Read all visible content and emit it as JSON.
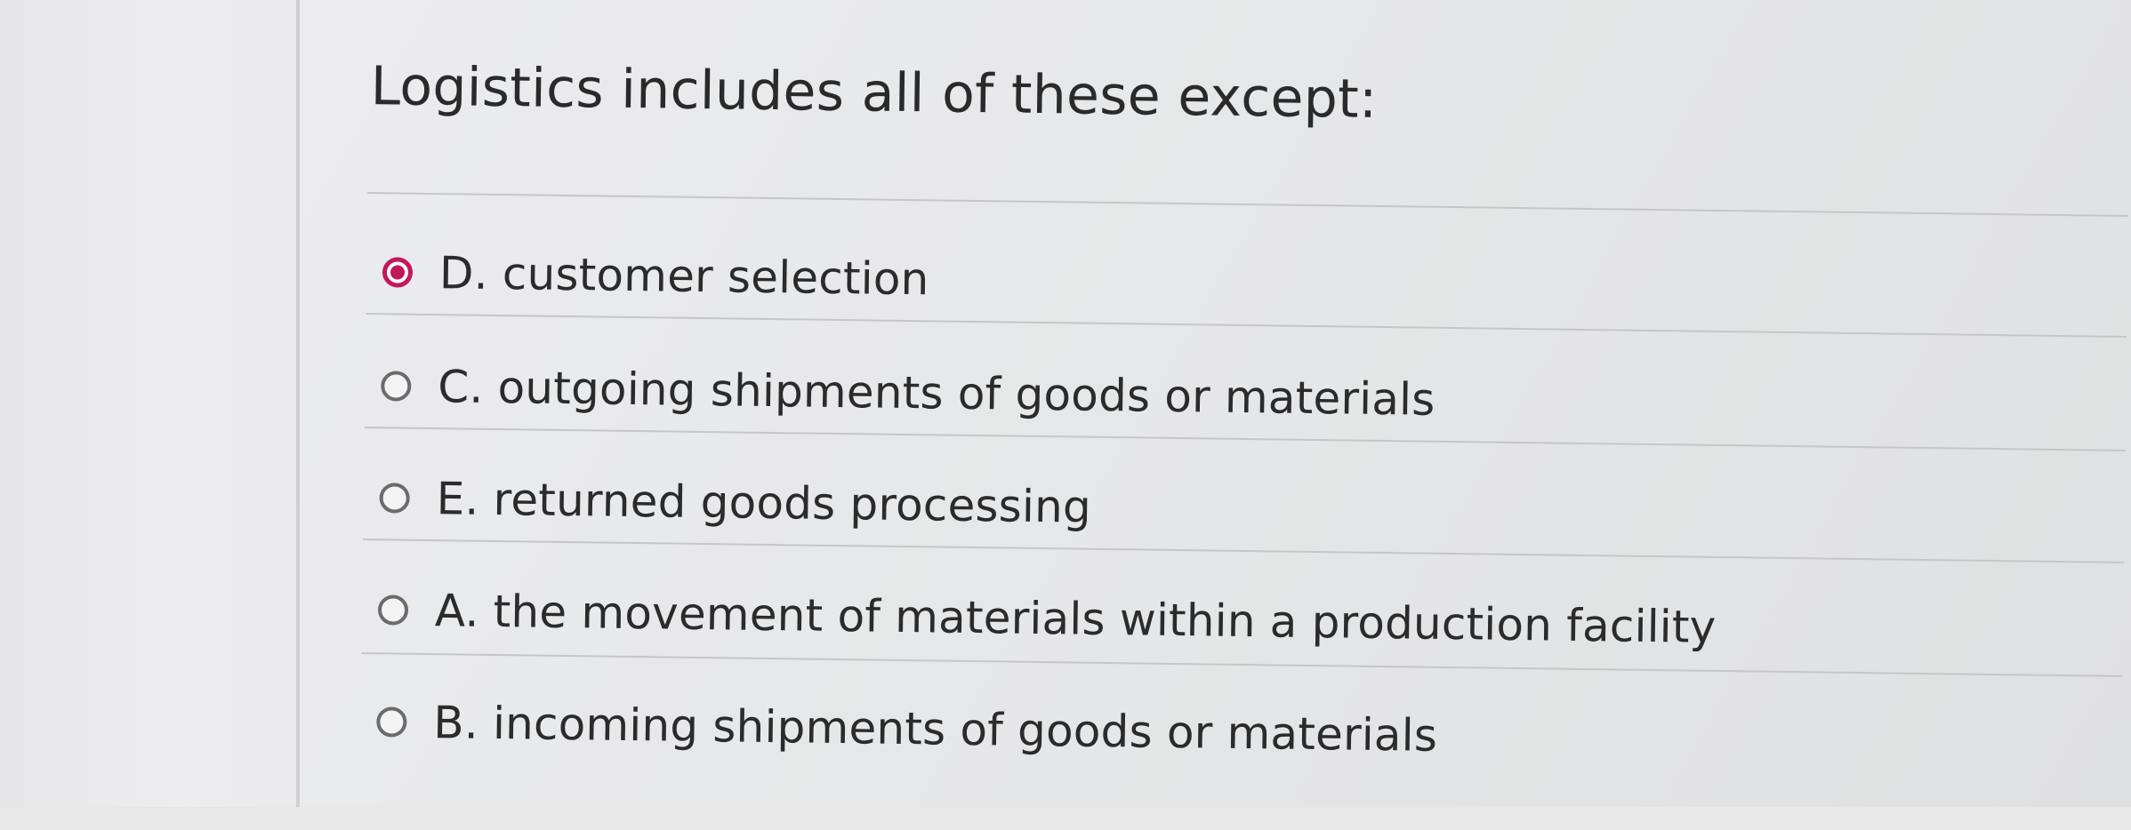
{
  "question": {
    "text": "Logistics includes all of these except:"
  },
  "options": [
    {
      "label": "D. customer selection",
      "selected": true
    },
    {
      "label": "C. outgoing shipments of goods or materials",
      "selected": false
    },
    {
      "label": "E. returned goods processing",
      "selected": false
    },
    {
      "label": "A. the movement of materials within a production facility",
      "selected": false
    },
    {
      "label": "B. incoming shipments of goods or materials",
      "selected": false
    }
  ],
  "colors": {
    "selected_radio": "#c2185b",
    "text": "#2b2b2b"
  }
}
